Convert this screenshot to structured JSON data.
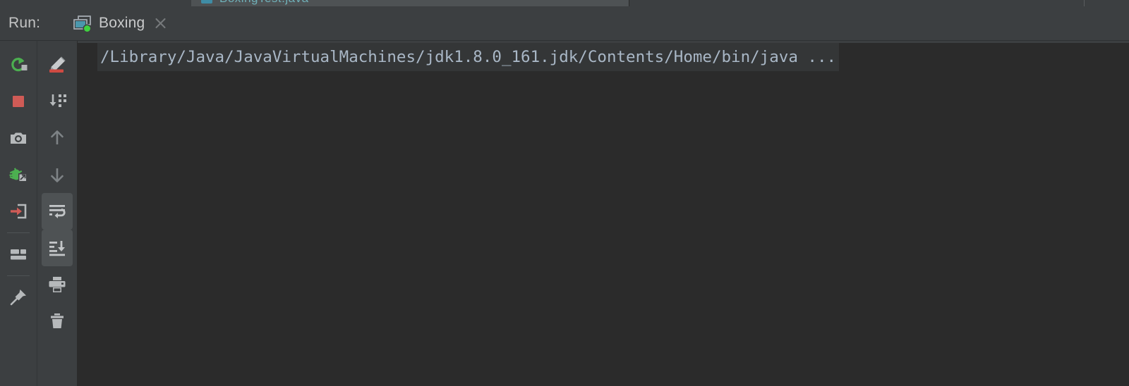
{
  "window": {
    "tool_window_label": "Run:",
    "background_color": "#3c3f41",
    "console_background_color": "#2b2b2b"
  },
  "editor_strip": {
    "partial_tab_label": "BoxingTest.java",
    "tab_text_color": "#6fb0b8"
  },
  "run_tab": {
    "label": "Boxing",
    "icon_name": "run-configuration-icon",
    "status": "running",
    "status_dot_color": "#3fd23f",
    "close_label": "×",
    "active": true
  },
  "left_toolbar": {
    "buttons": [
      {
        "name": "rerun-button",
        "label": "Rerun 'Boxing'",
        "icon": "rerun-icon",
        "active": false
      },
      {
        "name": "stop-button",
        "label": "Stop 'Boxing'",
        "icon": "stop-icon",
        "active": false
      },
      {
        "name": "camera-button",
        "label": "Dump Threads",
        "icon": "camera-icon",
        "active": false
      },
      {
        "name": "debug-restore-button",
        "label": "Restore Layout",
        "icon": "bug-export-icon",
        "active": false
      },
      {
        "name": "import-button",
        "label": "Import Test Results",
        "icon": "import-arrow-icon",
        "active": false
      },
      {
        "name": "layout-button",
        "label": "Layout Settings",
        "icon": "layout-icon",
        "active": false
      },
      {
        "name": "pin-button",
        "label": "Pin Tab",
        "icon": "pin-icon",
        "active": false
      }
    ]
  },
  "right_toolbar": {
    "buttons": [
      {
        "name": "highlight-button",
        "label": "Highlight",
        "icon": "pen-highlight-icon",
        "active": false
      },
      {
        "name": "filter-button",
        "label": "Filter",
        "icon": "sort-filter-icon",
        "active": false
      },
      {
        "name": "prev-occurrence-button",
        "label": "Up",
        "icon": "arrow-up-icon",
        "active": false
      },
      {
        "name": "next-occurrence-button",
        "label": "Down",
        "icon": "arrow-down-icon",
        "active": false
      },
      {
        "name": "soft-wrap-button",
        "label": "Use Soft Wraps",
        "icon": "soft-wrap-icon",
        "active": true
      },
      {
        "name": "scroll-to-end-button",
        "label": "Scroll to the end",
        "icon": "scroll-to-end-icon",
        "active": true
      },
      {
        "name": "print-button",
        "label": "Print",
        "icon": "printer-icon",
        "active": false
      },
      {
        "name": "clear-all-button",
        "label": "Clear All",
        "icon": "trash-icon",
        "active": false
      }
    ]
  },
  "console": {
    "command_line": "/Library/Java/JavaVirtualMachines/jdk1.8.0_161.jdk/Contents/Home/bin/java ...",
    "text_color": "#aeb5ba",
    "highlight_background": "#343637"
  }
}
